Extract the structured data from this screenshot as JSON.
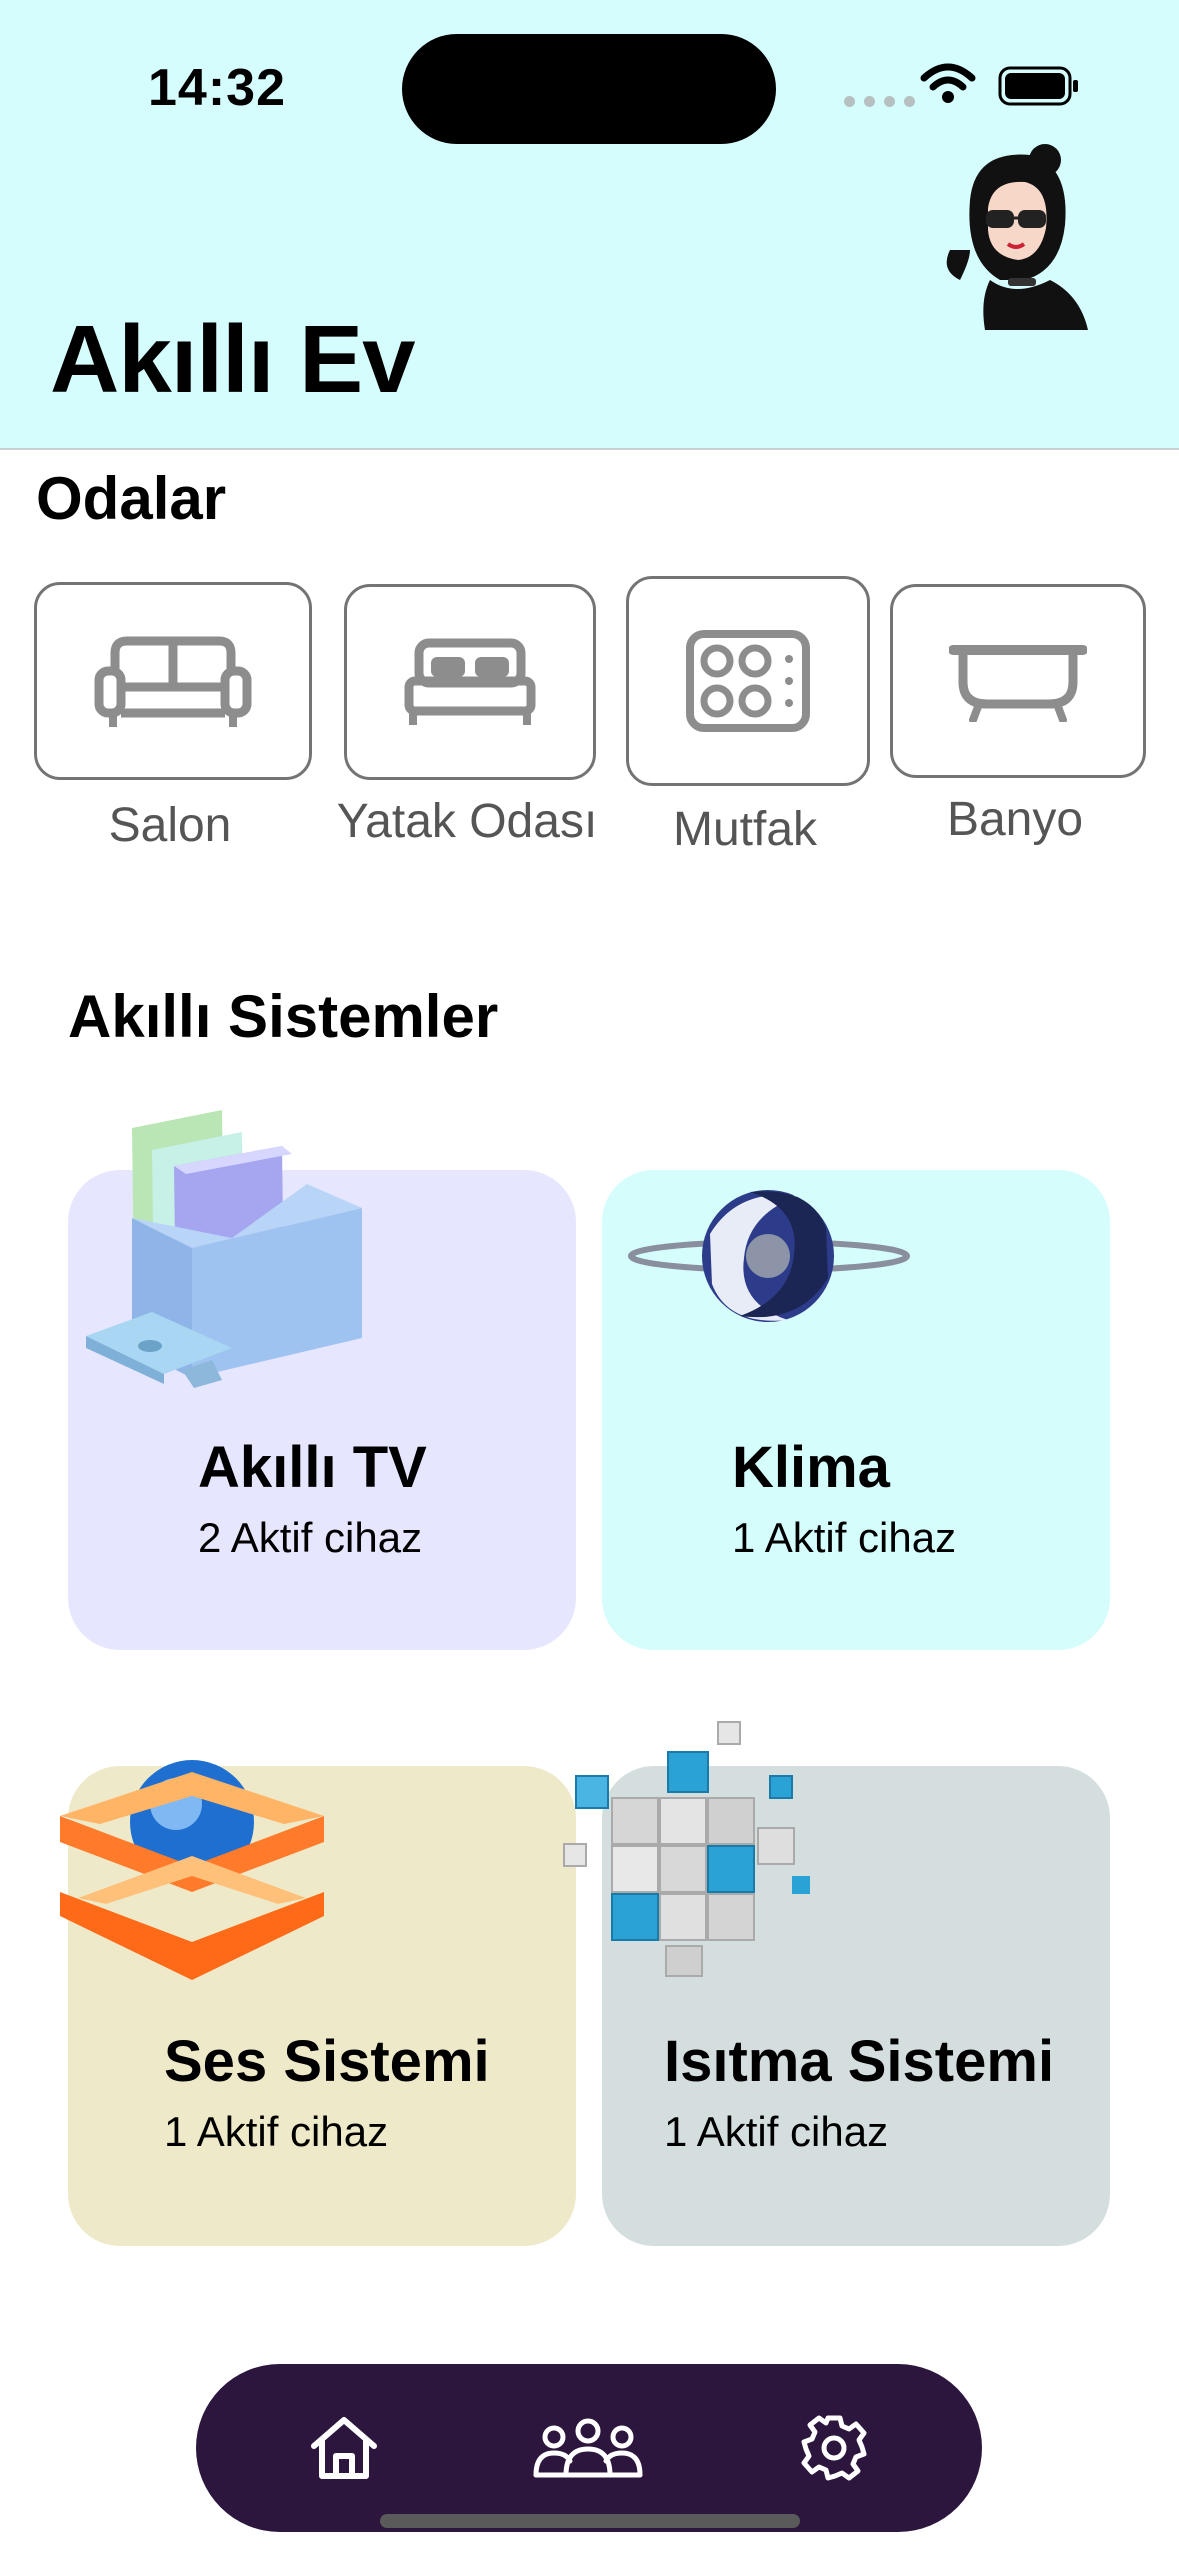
{
  "status_bar": {
    "time": "14:32"
  },
  "header": {
    "title": "Akıllı Ev"
  },
  "rooms": {
    "title": "Odalar",
    "items": [
      {
        "label": "Salon",
        "icon": "sofa-icon"
      },
      {
        "label": "Yatak Odası",
        "icon": "bed-icon"
      },
      {
        "label": "Mutfak",
        "icon": "stove-icon"
      },
      {
        "label": "Banyo",
        "icon": "bathtub-icon"
      }
    ]
  },
  "systems": {
    "title": "Akıllı Sistemler",
    "items": [
      {
        "title": "Akıllı TV",
        "subtitle": "2 Aktif cihaz",
        "color": "#e6e6ff"
      },
      {
        "title": "Klima",
        "subtitle": "1 Aktif cihaz",
        "color": "#d4fdfb"
      },
      {
        "title": "Ses Sistemi",
        "subtitle": "1 Aktif cihaz",
        "color": "#eee9c9"
      },
      {
        "title": "Isıtma Sistemi",
        "subtitle": "1 Aktif cihaz",
        "color": "#d5dede"
      }
    ]
  },
  "tabbar": {
    "items": [
      {
        "icon": "home-icon"
      },
      {
        "icon": "people-icon"
      },
      {
        "icon": "gear-icon"
      }
    ]
  },
  "colors": {
    "header_bg": "#d6fdfd",
    "tabbar_bg": "#2c163d"
  }
}
